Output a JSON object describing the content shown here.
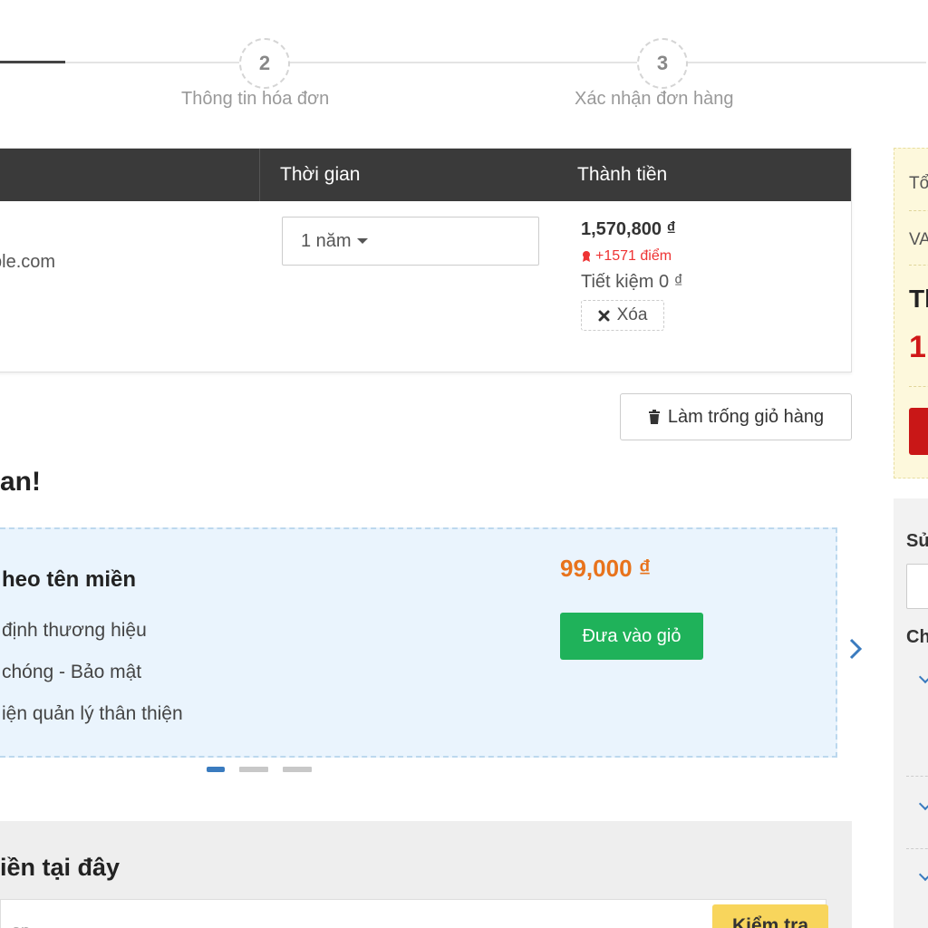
{
  "stepper": {
    "steps": [
      {
        "number": "2",
        "label": "Thông tin hóa đơn"
      },
      {
        "number": "3",
        "label": "Xác nhận đơn hàng"
      }
    ]
  },
  "cart": {
    "headers": {
      "period": "Thời gian",
      "total": "Thành tiền"
    },
    "item": {
      "domain": "ple.com",
      "period": "1 năm",
      "price": "1,570,800 ₫",
      "points": "+1571 điểm",
      "saving": "Tiết kiệm 0 ₫",
      "remove_label": "Xóa"
    },
    "empty_cart_label": "Làm trống giỏ hàng"
  },
  "promo": {
    "heading": "an!",
    "title": "heo tên miền",
    "features": [
      "định thương hiệu",
      "chóng - Bảo mật",
      "iện quản lý thân thiện"
    ],
    "price": "99,000 ₫",
    "add_label": "Đưa vào giỏ"
  },
  "domain_search": {
    "title": "iền tại đây",
    "placeholder": "an",
    "check_label": "Kiểm tra"
  },
  "summary": {
    "row1": "Tổ",
    "row2": "VA",
    "title": "Th",
    "total": "1"
  },
  "side_panel": {
    "label1": "Sử",
    "label2": "Ch"
  },
  "colors": {
    "accent_green": "#1fb25a",
    "price_orange": "#e8731c",
    "total_red": "#d01818",
    "table_header": "#3a3a3a"
  }
}
